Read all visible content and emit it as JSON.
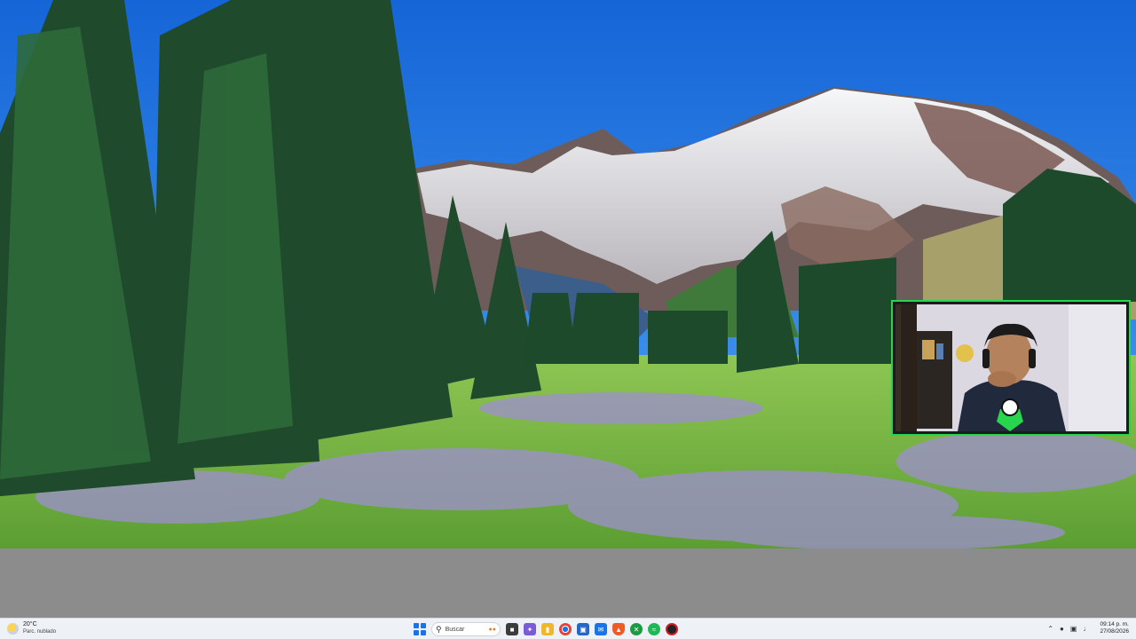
{
  "taskbar": {
    "weather": {
      "temperature": "20°C",
      "condition": "Parc. nublado",
      "icon": "partly-cloudy-icon"
    },
    "search": {
      "label": "Buscar",
      "icon": "search-icon"
    },
    "apps": [
      {
        "name": "task-view-icon",
        "color": "#3c3c3c"
      },
      {
        "name": "copilot-icon",
        "color": "#7b5cd6"
      },
      {
        "name": "file-explorer-icon",
        "color": "#f2b62d"
      },
      {
        "name": "chrome-icon",
        "color": "#e94235"
      },
      {
        "name": "store-icon",
        "color": "#2467c9"
      },
      {
        "name": "outlook-icon",
        "color": "#1a73e8"
      },
      {
        "name": "brave-icon",
        "color": "#f05a24"
      },
      {
        "name": "xbox-icon",
        "color": "#1d9b42"
      },
      {
        "name": "spotify-icon",
        "color": "#1db954"
      },
      {
        "name": "recording-app-icon",
        "color": "#d11f2a"
      }
    ],
    "tray": {
      "icons": [
        "chevron-up-icon",
        "microphone-icon",
        "network-icon",
        "volume-icon"
      ],
      "time": "09:14 p. m.",
      "date": "27/08/2026"
    }
  },
  "colors": {
    "accent": "#27d64c",
    "start": "#1a73e8"
  }
}
